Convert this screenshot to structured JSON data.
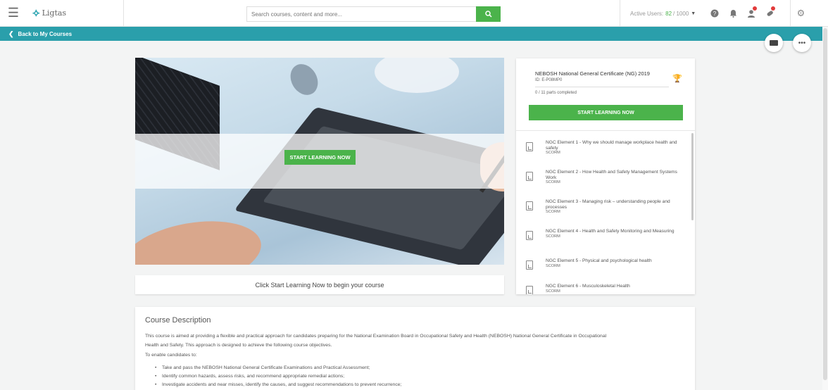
{
  "topbar": {
    "logo_text": "Ligtas",
    "search_placeholder": "Search courses, content and more...",
    "active_users_label": "Active Users:",
    "active_users_count": "82",
    "active_users_total": "/ 1000"
  },
  "backbar": {
    "label": "Back to My Courses"
  },
  "hero": {
    "button_label": "START LEARNING NOW"
  },
  "caption": "Click Start Learning Now to begin your course",
  "panel": {
    "title": "NEBOSH National General Certificate (NG) 2019",
    "id": "ID: E-P08MP0",
    "progress": "0 / 11 parts completed",
    "button_label": "START LEARNING NOW",
    "items": [
      {
        "title": "NGC Element 1 - Why we should manage workplace health and safety",
        "type": "SCORM"
      },
      {
        "title": "NGC Element 2 - How Health and Safety Management Systems Work",
        "type": "SCORM"
      },
      {
        "title": "NGC Element 3 - Managing risk – understanding people and processes",
        "type": "SCORM"
      },
      {
        "title": "NGC Element 4 - Health and Safety Monitoring and Measuring",
        "type": "SCORM"
      },
      {
        "title": "NGC Element 5 - Physical and psychological health",
        "type": "SCORM"
      },
      {
        "title": "NGC Element 6 - Musculoskeletal Health",
        "type": "SCORM"
      }
    ]
  },
  "description": {
    "heading": "Course Description",
    "paragraph_1": "This course is aimed at providing a flexible and practical approach for candidates preparing for the National Examination Board in Occupational Safety and Health (NEBOSH) National General Certificate in Occupational",
    "paragraph_1b": "Health and Safety. This approach is designed to achieve the following course objectives.",
    "paragraph_2": "To enable candidates to:",
    "bullets": [
      "Take and pass the NEBOSH National General Certificate Examinations and Practical Assessment;",
      "Identify common hazards, assess risks, and recommend appropriate remedial actions;",
      "Investigate accidents and near misses, identify the causes, and suggest recommendations to prevent recurrence;"
    ]
  },
  "colors": {
    "accent_teal": "#2a9fab",
    "accent_green": "#4bb34b",
    "notification_red": "#e23b3b"
  }
}
